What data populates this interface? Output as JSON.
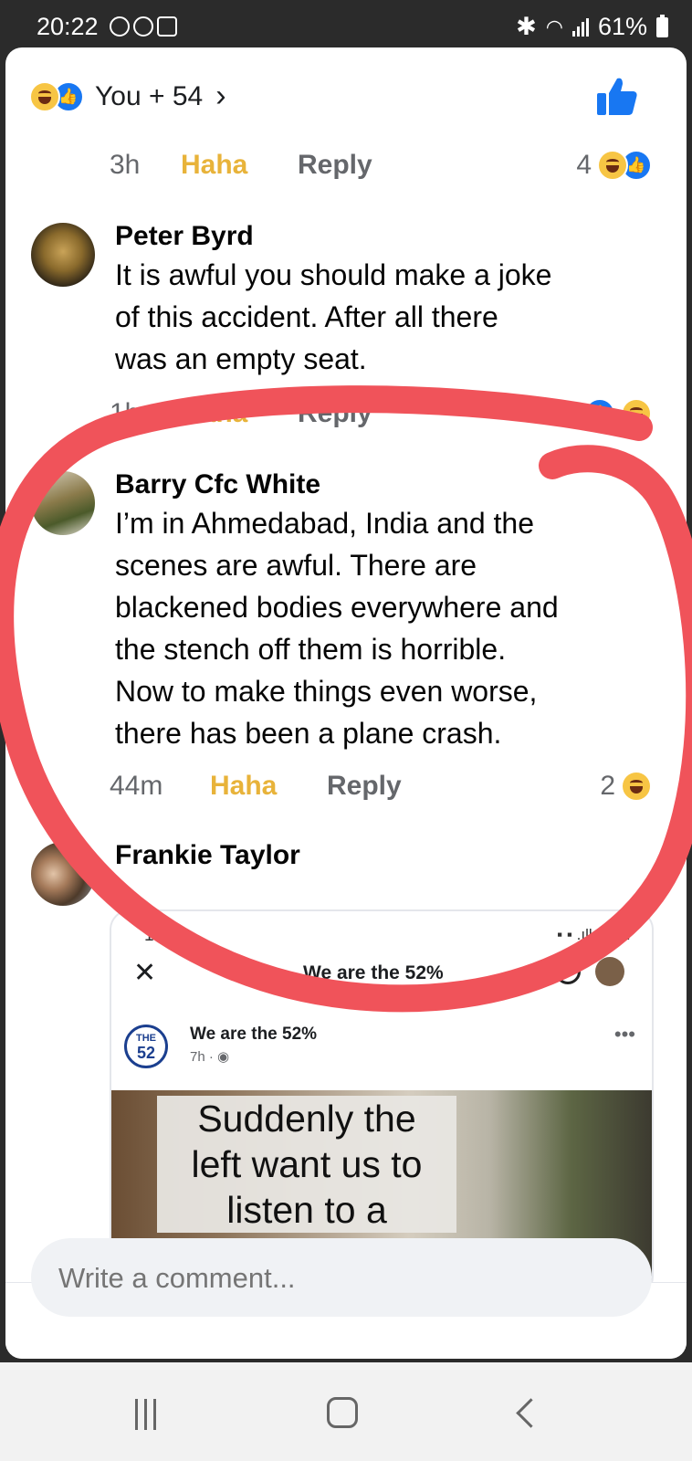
{
  "status_bar": {
    "time": "20:22",
    "battery": "61%"
  },
  "reactions_header": {
    "label": "You + 54"
  },
  "comments": [
    {
      "time": "3h",
      "reaction": "Haha",
      "reply": "Reply",
      "reaction_count": "4"
    },
    {
      "author": "Peter Byrd",
      "lines": [
        "It is awful you should make a joke",
        "of this accident. After all there",
        "was an empty seat."
      ],
      "time": "1h",
      "reaction": "Haha",
      "reply": "Reply"
    },
    {
      "author": "Barry Cfc White",
      "lines": [
        "I’m in Ahmedabad, India and the",
        "scenes are awful. There are",
        "blackened bodies everywhere and",
        "the stench off them is horrible.",
        "Now to make things even worse,",
        "there has been a plane crash."
      ],
      "time": "44m",
      "reaction": "Haha",
      "reply": "Reply",
      "reaction_count": "2"
    },
    {
      "author": "Frankie Taylor"
    }
  ],
  "embedded": {
    "status_time": "18:23",
    "status_right": "47",
    "title": "We are the 52%",
    "page_name": "We are the 52%",
    "logo_top": "THE",
    "logo_bottom": "52",
    "post_time": "7h · ",
    "image_text": [
      "Suddenly the",
      "left want us to",
      "listen to a"
    ]
  },
  "composer": {
    "placeholder": "Write a comment..."
  },
  "colors": {
    "annotation_marker": "#f0535a",
    "haha": "#e8b33a",
    "facebook_blue": "#1877f2"
  }
}
